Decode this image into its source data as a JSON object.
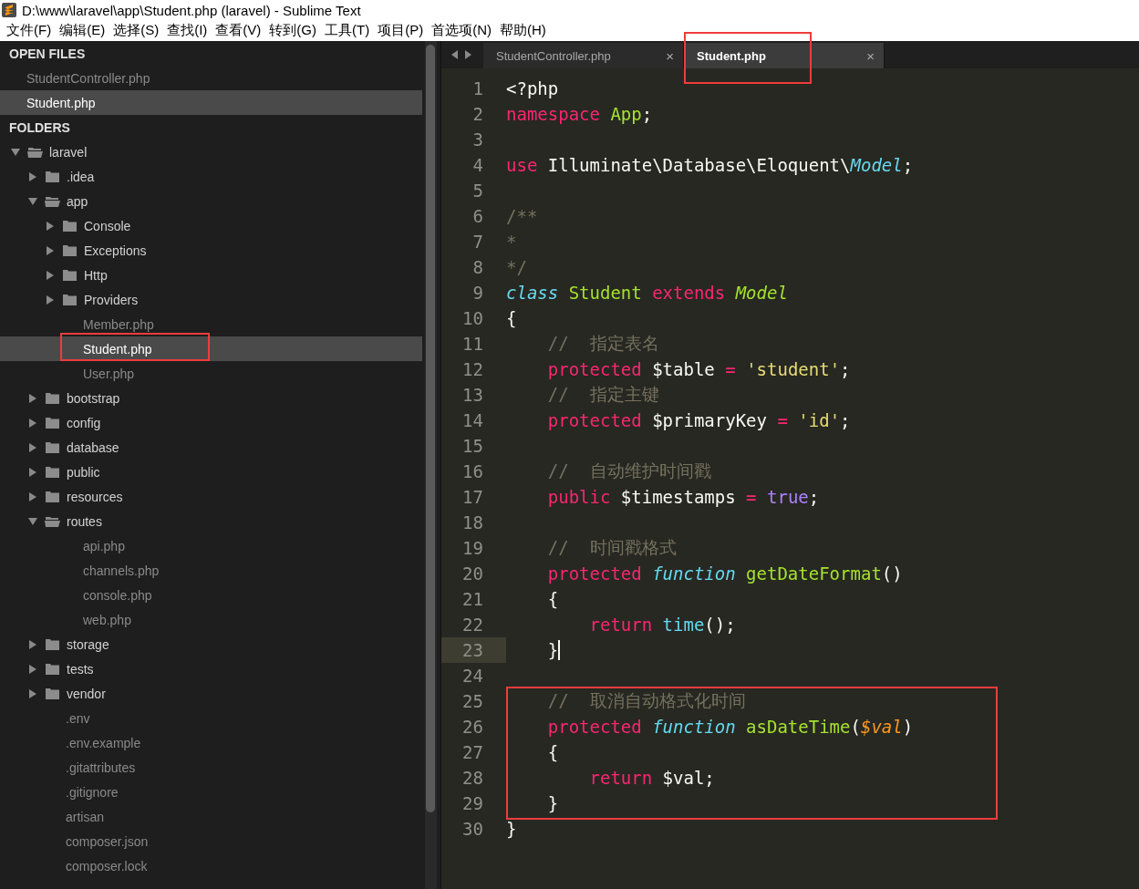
{
  "window": {
    "title": "D:\\www\\laravel\\app\\Student.php (laravel) - Sublime Text"
  },
  "menu": [
    "文件(F)",
    "编辑(E)",
    "选择(S)",
    "查找(I)",
    "查看(V)",
    "转到(G)",
    "工具(T)",
    "项目(P)",
    "首选项(N)",
    "帮助(H)"
  ],
  "sidebar": {
    "open_files_title": "OPEN FILES",
    "open_files": [
      {
        "label": "StudentController.php",
        "selected": false
      },
      {
        "label": "Student.php",
        "selected": true
      }
    ],
    "folders_title": "FOLDERS",
    "tree": [
      {
        "label": "laravel",
        "kind": "folder",
        "expanded": true,
        "children": [
          {
            "label": ".idea",
            "kind": "folder",
            "expanded": false
          },
          {
            "label": "app",
            "kind": "folder",
            "expanded": true,
            "children": [
              {
                "label": "Console",
                "kind": "folder",
                "expanded": false
              },
              {
                "label": "Exceptions",
                "kind": "folder",
                "expanded": false
              },
              {
                "label": "Http",
                "kind": "folder",
                "expanded": false
              },
              {
                "label": "Providers",
                "kind": "folder",
                "expanded": false
              },
              {
                "label": "Member.php",
                "kind": "file",
                "selected": false,
                "annotated": false
              },
              {
                "label": "Student.php",
                "kind": "file",
                "selected": true,
                "annotated": true
              },
              {
                "label": "User.php",
                "kind": "file",
                "selected": false,
                "annotated": false
              }
            ]
          },
          {
            "label": "bootstrap",
            "kind": "folder",
            "expanded": false
          },
          {
            "label": "config",
            "kind": "folder",
            "expanded": false
          },
          {
            "label": "database",
            "kind": "folder",
            "expanded": false
          },
          {
            "label": "public",
            "kind": "folder",
            "expanded": false
          },
          {
            "label": "resources",
            "kind": "folder",
            "expanded": false
          },
          {
            "label": "routes",
            "kind": "folder",
            "expanded": true,
            "children": [
              {
                "label": "api.php",
                "kind": "file",
                "selected": false,
                "annotated": false
              },
              {
                "label": "channels.php",
                "kind": "file",
                "selected": false,
                "annotated": false
              },
              {
                "label": "console.php",
                "kind": "file",
                "selected": false,
                "annotated": false
              },
              {
                "label": "web.php",
                "kind": "file",
                "selected": false,
                "annotated": false
              }
            ]
          },
          {
            "label": "storage",
            "kind": "folder",
            "expanded": false
          },
          {
            "label": "tests",
            "kind": "folder",
            "expanded": false
          },
          {
            "label": "vendor",
            "kind": "folder",
            "expanded": false
          },
          {
            "label": ".env",
            "kind": "file",
            "selected": false,
            "annotated": false
          },
          {
            "label": ".env.example",
            "kind": "file",
            "selected": false,
            "annotated": false
          },
          {
            "label": ".gitattributes",
            "kind": "file",
            "selected": false,
            "annotated": false
          },
          {
            "label": ".gitignore",
            "kind": "file",
            "selected": false,
            "annotated": false
          },
          {
            "label": "artisan",
            "kind": "file",
            "selected": false,
            "annotated": false
          },
          {
            "label": "composer.json",
            "kind": "file",
            "selected": false,
            "annotated": false
          },
          {
            "label": "composer.lock",
            "kind": "file",
            "selected": false,
            "annotated": false
          }
        ]
      }
    ]
  },
  "tabs": [
    {
      "label": "StudentController.php",
      "close": "×",
      "selected": false,
      "annotated": false
    },
    {
      "label": "Student.php",
      "close": "×",
      "selected": true,
      "annotated": true
    }
  ],
  "code": [
    {
      "n": "1",
      "tokens": [
        {
          "text": "<?php",
          "kind": "plain"
        }
      ]
    },
    {
      "n": "2",
      "tokens": [
        {
          "text": "namespace",
          "kind": "keyword"
        },
        {
          "text": " App",
          "kind": "entity"
        },
        {
          "text": ";",
          "kind": "plain"
        }
      ]
    },
    {
      "n": "3"
    },
    {
      "n": "4",
      "tokens": [
        {
          "text": "use",
          "kind": "keyword"
        },
        {
          "text": " Illuminate\\Database\\Eloquent\\",
          "kind": "plain"
        },
        {
          "text": "Model",
          "kind": "storage"
        },
        {
          "text": ";",
          "kind": "plain"
        }
      ]
    },
    {
      "n": "5"
    },
    {
      "n": "6",
      "tokens": [
        {
          "text": "/**",
          "kind": "comment"
        }
      ]
    },
    {
      "n": "7",
      "tokens": [
        {
          "text": "*",
          "kind": "comment"
        }
      ]
    },
    {
      "n": "8",
      "tokens": [
        {
          "text": "*/",
          "kind": "comment"
        }
      ]
    },
    {
      "n": "9",
      "tokens": [
        {
          "text": "class",
          "kind": "storage"
        },
        {
          "text": " Student",
          "kind": "entity"
        },
        {
          "text": " extends",
          "kind": "keyword"
        },
        {
          "text": " Model",
          "kind": "inherited"
        }
      ]
    },
    {
      "n": "10",
      "tokens": [
        {
          "text": "{",
          "kind": "plain"
        }
      ]
    },
    {
      "n": "11",
      "tokens": [
        {
          "text": "    //  指定表名",
          "kind": "comment"
        }
      ]
    },
    {
      "n": "12",
      "tokens": [
        {
          "text": "    protected",
          "kind": "keyword"
        },
        {
          "text": " $table ",
          "kind": "plain"
        },
        {
          "text": "=",
          "kind": "keyword"
        },
        {
          "text": " 'student'",
          "kind": "string"
        },
        {
          "text": ";",
          "kind": "plain"
        }
      ]
    },
    {
      "n": "13",
      "tokens": [
        {
          "text": "    //  指定主键",
          "kind": "comment"
        }
      ]
    },
    {
      "n": "14",
      "tokens": [
        {
          "text": "    protected",
          "kind": "keyword"
        },
        {
          "text": " $primaryKey ",
          "kind": "plain"
        },
        {
          "text": "=",
          "kind": "keyword"
        },
        {
          "text": " 'id'",
          "kind": "string"
        },
        {
          "text": ";",
          "kind": "plain"
        }
      ]
    },
    {
      "n": "15"
    },
    {
      "n": "16",
      "tokens": [
        {
          "text": "    //  自动维护时间戳",
          "kind": "comment"
        }
      ]
    },
    {
      "n": "17",
      "tokens": [
        {
          "text": "    public",
          "kind": "keyword"
        },
        {
          "text": " $timestamps ",
          "kind": "plain"
        },
        {
          "text": "=",
          "kind": "keyword"
        },
        {
          "text": " true",
          "kind": "constant"
        },
        {
          "text": ";",
          "kind": "plain"
        }
      ]
    },
    {
      "n": "18"
    },
    {
      "n": "19",
      "tokens": [
        {
          "text": "    //  时间戳格式",
          "kind": "comment"
        }
      ]
    },
    {
      "n": "20",
      "tokens": [
        {
          "text": "    protected",
          "kind": "keyword"
        },
        {
          "text": " function",
          "kind": "storage"
        },
        {
          "text": " getDateFormat",
          "kind": "entity"
        },
        {
          "text": "()",
          "kind": "plain"
        }
      ]
    },
    {
      "n": "21",
      "tokens": [
        {
          "text": "    {",
          "kind": "plain"
        }
      ]
    },
    {
      "n": "22",
      "tokens": [
        {
          "text": "        return",
          "kind": "keyword"
        },
        {
          "text": " time",
          "kind": "support"
        },
        {
          "text": "();",
          "kind": "plain"
        }
      ]
    },
    {
      "n": "23",
      "current": true,
      "tokens": [
        {
          "text": "    }",
          "kind": "plain"
        }
      ]
    },
    {
      "n": "24"
    },
    {
      "n": "25",
      "boxed": true,
      "tokens": [
        {
          "text": "    //  取消自动格式化时间",
          "kind": "comment"
        }
      ]
    },
    {
      "n": "26",
      "boxed": true,
      "tokens": [
        {
          "text": "    protected",
          "kind": "keyword"
        },
        {
          "text": " function",
          "kind": "storage"
        },
        {
          "text": " asDateTime",
          "kind": "entity"
        },
        {
          "text": "(",
          "kind": "plain"
        },
        {
          "text": "$val",
          "kind": "parameter"
        },
        {
          "text": ")",
          "kind": "plain"
        }
      ]
    },
    {
      "n": "27",
      "boxed": true,
      "tokens": [
        {
          "text": "    {",
          "kind": "plain"
        }
      ]
    },
    {
      "n": "28",
      "boxed": true,
      "tokens": [
        {
          "text": "        return",
          "kind": "keyword"
        },
        {
          "text": " $val;",
          "kind": "plain"
        }
      ]
    },
    {
      "n": "29",
      "boxed": true,
      "tokens": [
        {
          "text": "    }",
          "kind": "plain"
        }
      ]
    },
    {
      "n": "30",
      "tokens": [
        {
          "text": "}",
          "kind": "plain"
        }
      ]
    }
  ]
}
